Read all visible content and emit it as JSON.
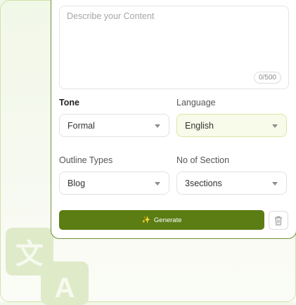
{
  "content": {
    "placeholder": "Describe your Content",
    "counter": "0/500"
  },
  "tone": {
    "label": "Tone",
    "value": "Formal"
  },
  "language": {
    "label": "Language",
    "value": "English"
  },
  "outline": {
    "label": "Outline Types",
    "value": "Blog"
  },
  "sections": {
    "label": "No of Section",
    "value": "3sections"
  },
  "actions": {
    "generate_label": "Generate",
    "generate_icon": "magic-wand-icon",
    "delete_icon": "trash-icon"
  },
  "background": {
    "glyph_translate": "文",
    "glyph_a": "A"
  },
  "colors": {
    "accent": "#5b7d14",
    "card_border": "#6f8f3a",
    "language_highlight": "#f8fbea"
  }
}
